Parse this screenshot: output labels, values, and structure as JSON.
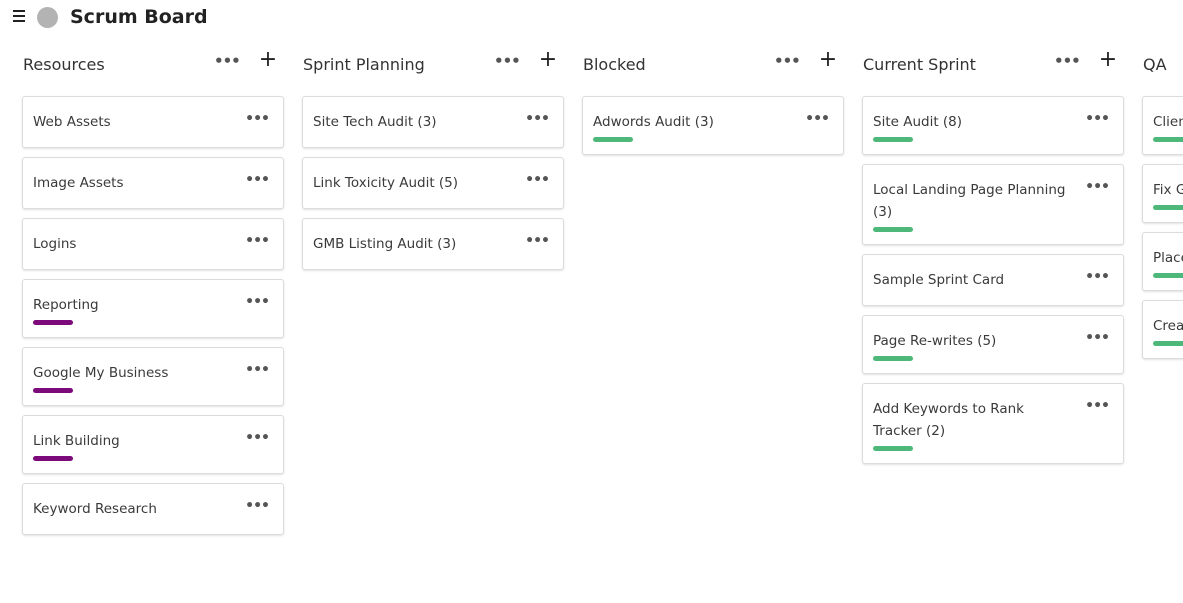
{
  "app": {
    "title": "Scrum Board"
  },
  "colors": {
    "purple_label": "#7d0a7b",
    "green_label": "#4db87a"
  },
  "icons": {
    "menu": "hamburger-icon",
    "avatar": "avatar",
    "column_more": "more-horizontal-icon",
    "column_add": "plus-icon",
    "card_more": "more-horizontal-icon"
  },
  "columns": [
    {
      "title": "Resources",
      "more": "•••",
      "add": "+",
      "cards": [
        {
          "title": "Web Assets",
          "label": null
        },
        {
          "title": "Image Assets",
          "label": null
        },
        {
          "title": "Logins",
          "label": null
        },
        {
          "title": "Reporting",
          "label": "purple"
        },
        {
          "title": "Google My Business",
          "label": "purple"
        },
        {
          "title": "Link Building",
          "label": "purple"
        },
        {
          "title": "Keyword Research",
          "label": null
        }
      ]
    },
    {
      "title": "Sprint Planning",
      "more": "•••",
      "add": "+",
      "cards": [
        {
          "title": "Site Tech Audit (3)",
          "label": null
        },
        {
          "title": "Link Toxicity Audit (5)",
          "label": null
        },
        {
          "title": "GMB Listing Audit (3)",
          "label": null
        }
      ]
    },
    {
      "title": "Blocked",
      "more": "•••",
      "add": "+",
      "cards": [
        {
          "title": "Adwords Audit (3)",
          "label": "green"
        }
      ]
    },
    {
      "title": "Current Sprint",
      "more": "•••",
      "add": "+",
      "cards": [
        {
          "title": "Site Audit (8)",
          "label": "green"
        },
        {
          "title": "Local Landing Page Planning (3)",
          "label": "green"
        },
        {
          "title": "Sample Sprint Card",
          "label": null
        },
        {
          "title": "Page Re-writes (5)",
          "label": "green"
        },
        {
          "title": "Add Keywords to Rank Tracker (2)",
          "label": "green"
        }
      ]
    },
    {
      "title": "QA",
      "more": "•••",
      "add": "+",
      "cards": [
        {
          "title": "Client",
          "label": "green"
        },
        {
          "title": "Fix G",
          "label": "green"
        },
        {
          "title": "Place",
          "label": "green"
        },
        {
          "title": "Crea",
          "label": "green"
        }
      ]
    }
  ]
}
